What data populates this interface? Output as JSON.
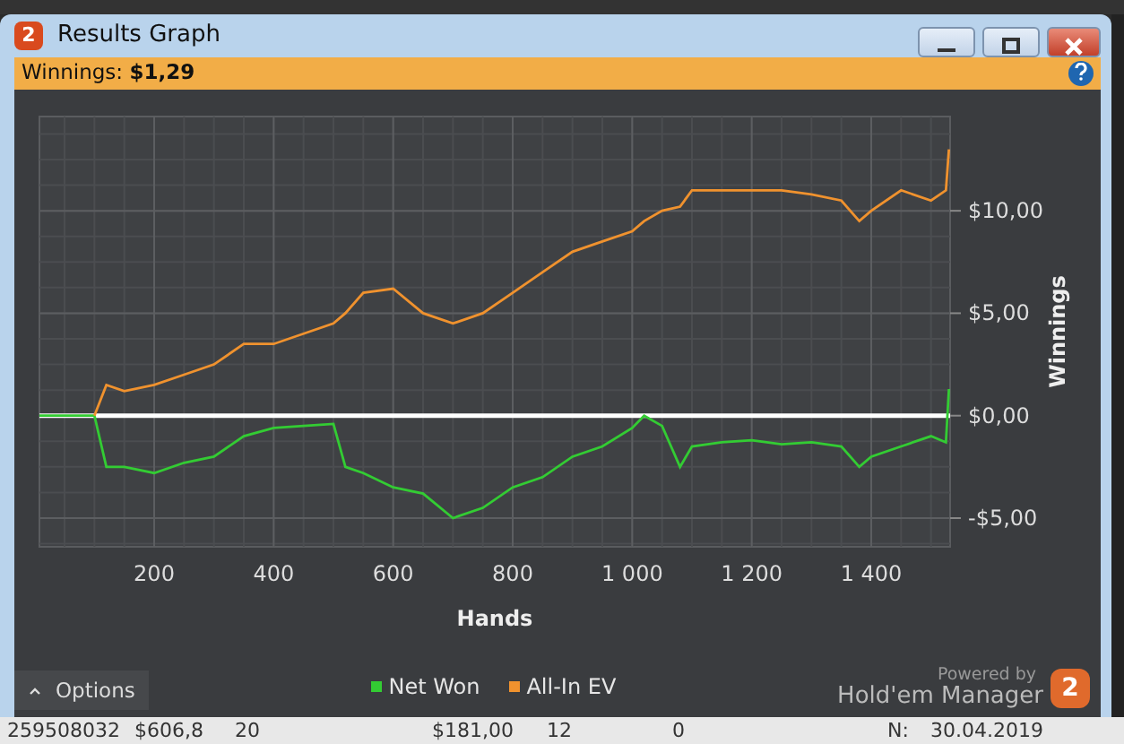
{
  "window": {
    "title": "Results Graph"
  },
  "summary": {
    "label": "Winnings:",
    "value": "$1,29"
  },
  "chart_data": {
    "type": "line",
    "xlabel": "Hands",
    "ylabel": "Winnings",
    "xlim": [
      8,
      1532
    ],
    "ylim": [
      -6.4,
      14.6
    ],
    "grid": true,
    "xticks": [
      {
        "value": 200,
        "label": "200"
      },
      {
        "value": 400,
        "label": "400"
      },
      {
        "value": 600,
        "label": "600"
      },
      {
        "value": 800,
        "label": "800"
      },
      {
        "value": 1000,
        "label": "1 000"
      },
      {
        "value": 1200,
        "label": "1 200"
      },
      {
        "value": 1400,
        "label": "1 400"
      }
    ],
    "yticks": [
      {
        "value": -5,
        "label": "-$5,00"
      },
      {
        "value": 0,
        "label": "$0,00"
      },
      {
        "value": 5,
        "label": "$5,00"
      },
      {
        "value": 10,
        "label": "$10,00"
      }
    ],
    "x": [
      8,
      50,
      100,
      120,
      150,
      200,
      250,
      300,
      350,
      400,
      450,
      500,
      520,
      550,
      600,
      650,
      700,
      750,
      800,
      850,
      900,
      950,
      1000,
      1020,
      1050,
      1080,
      1100,
      1150,
      1200,
      1250,
      1300,
      1350,
      1380,
      1400,
      1450,
      1500,
      1525,
      1530
    ],
    "series": [
      {
        "name": "Net Won",
        "color": "#33cc33",
        "values": [
          0,
          0,
          0,
          -2.5,
          -2.5,
          -2.8,
          -2.3,
          -2,
          -1,
          -0.6,
          -0.5,
          -0.4,
          -2.5,
          -2.8,
          -3.5,
          -3.8,
          -5,
          -4.5,
          -3.5,
          -3,
          -2,
          -1.5,
          -0.6,
          0,
          -0.5,
          -2.5,
          -1.5,
          -1.3,
          -1.2,
          -1.4,
          -1.3,
          -1.5,
          -2.5,
          -2,
          -1.5,
          -1,
          -1.3,
          1.3
        ]
      },
      {
        "name": "All-In EV",
        "color": "#f0922e",
        "values": [
          null,
          null,
          0,
          1.5,
          1.2,
          1.5,
          2,
          2.5,
          3.5,
          3.5,
          4,
          4.5,
          5,
          6,
          6.2,
          5,
          4.5,
          5,
          6,
          7,
          8,
          8.5,
          9,
          9.5,
          10,
          10.2,
          11,
          11,
          11,
          11,
          10.8,
          10.5,
          9.5,
          10,
          11,
          10.5,
          11,
          13
        ]
      }
    ]
  },
  "options_button": "Options",
  "branding": {
    "caption": "Powered by",
    "product": "Hold'em Manager",
    "mark": "2"
  },
  "title_mark": "2",
  "background_row": [
    "259508032",
    "$606,8",
    "20",
    "$181,00",
    "12",
    "0",
    "N:",
    "30.04.2019"
  ]
}
